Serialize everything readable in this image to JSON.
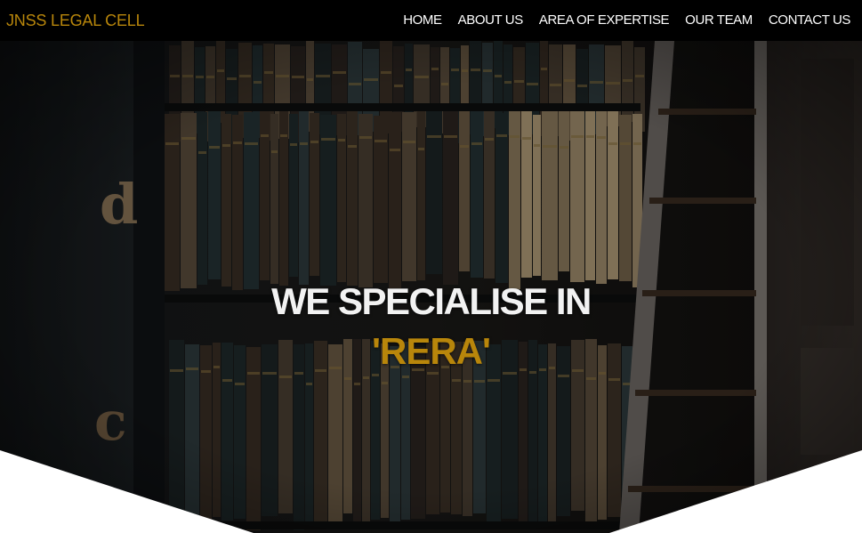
{
  "brand": {
    "name": "JNSS LEGAL CELL"
  },
  "nav": {
    "items": [
      {
        "label": "HOME"
      },
      {
        "label": "ABOUT US"
      },
      {
        "label": "AREA OF EXPERTISE"
      },
      {
        "label": "OUR TEAM"
      },
      {
        "label": "CONTACT US"
      }
    ]
  },
  "hero": {
    "heading": "WE SPECIALISE IN",
    "highlight": "'RERA'",
    "background_subject": "library-bookshelf-photo",
    "spine_letters": [
      "d",
      "c"
    ]
  },
  "colors": {
    "accent": "#b8860b",
    "nav_background": "#000000",
    "nav_text": "#ffffff",
    "heading_text": "#f2f2f2"
  }
}
